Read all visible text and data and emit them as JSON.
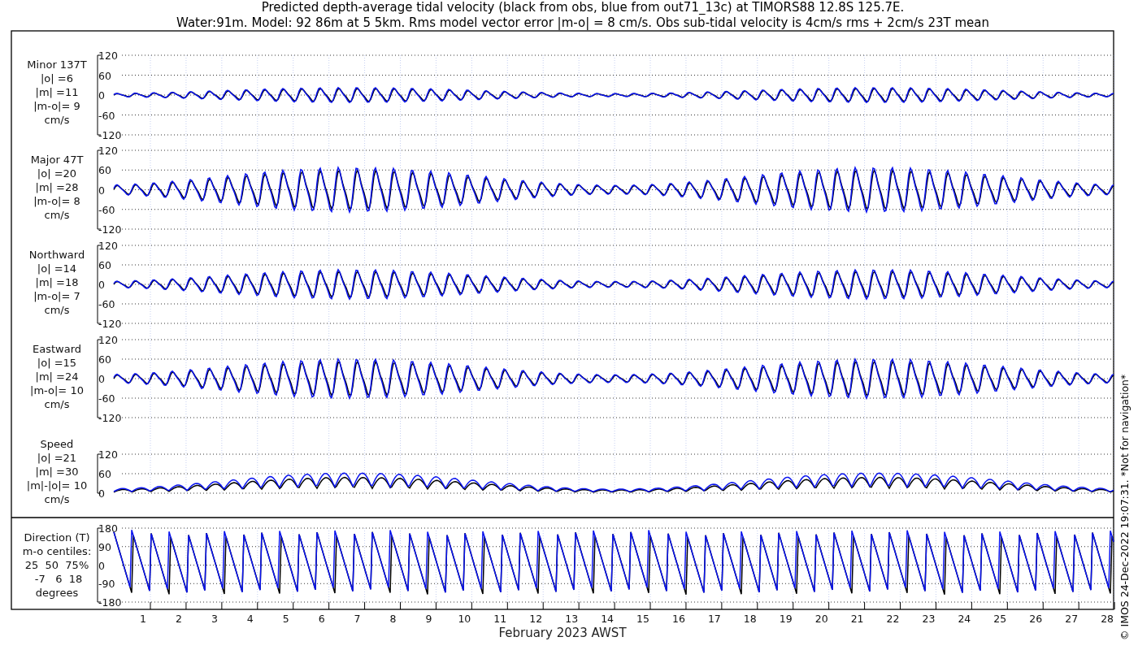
{
  "title_lines": [
    "Predicted depth-average tidal velocity (black from obs, blue from out71_13c) at TIMORS88 12.8S 125.7E.",
    "Water:91m. Model: 92 86m at 5 5km. Rms model vector error |m-o| = 8 cm/s. Obs sub-tidal velocity is 4cm/s rms + 2cm/s 23T mean"
  ],
  "panels": [
    {
      "kind": "velocity",
      "label_lines": [
        "Minor 137T",
        "|o| =6",
        "|m| =11",
        "|m-o|= 9",
        "cm/s"
      ],
      "yticks": [
        "120",
        "60",
        "0",
        "-60",
        "-120"
      ]
    },
    {
      "kind": "velocity",
      "label_lines": [
        "Major 47T",
        "|o| =20",
        "|m| =28",
        "|m-o|= 8",
        "cm/s"
      ],
      "yticks": [
        "120",
        "60",
        "0",
        "-60",
        "-120"
      ]
    },
    {
      "kind": "velocity",
      "label_lines": [
        "Northward",
        "|o| =14",
        "|m| =18",
        "|m-o|= 7",
        "cm/s"
      ],
      "yticks": [
        "120",
        "60",
        "0",
        "-60",
        "-120"
      ]
    },
    {
      "kind": "velocity",
      "label_lines": [
        "Eastward",
        "|o| =15",
        "|m| =24",
        "|m-o|= 10",
        "cm/s"
      ],
      "yticks": [
        "120",
        "60",
        "0",
        "-60",
        "-120"
      ]
    },
    {
      "kind": "speed",
      "label_lines": [
        "Speed",
        "|o| =21",
        "|m| =30",
        "|m|-|o|= 10",
        "cm/s"
      ],
      "yticks": [
        "120",
        "60",
        "0"
      ]
    },
    {
      "kind": "direction",
      "label_lines": [
        "Direction (T)",
        "m-o centiles:",
        "25  50  75%",
        " -7   6  18",
        "degrees"
      ],
      "yticks": [
        "180",
        "90",
        "0",
        "-90",
        "-180"
      ]
    }
  ],
  "x_ticks": [
    "1",
    "2",
    "3",
    "4",
    "5",
    "6",
    "7",
    "8",
    "9",
    "10",
    "11",
    "12",
    "13",
    "14",
    "15",
    "16",
    "17",
    "18",
    "19",
    "20",
    "21",
    "22",
    "23",
    "24",
    "25",
    "26",
    "27",
    "28"
  ],
  "x_label": "February 2023 AWST",
  "side_note": "© IMOS 24-Dec-2022 19:07:31. *Not for navigation*"
}
